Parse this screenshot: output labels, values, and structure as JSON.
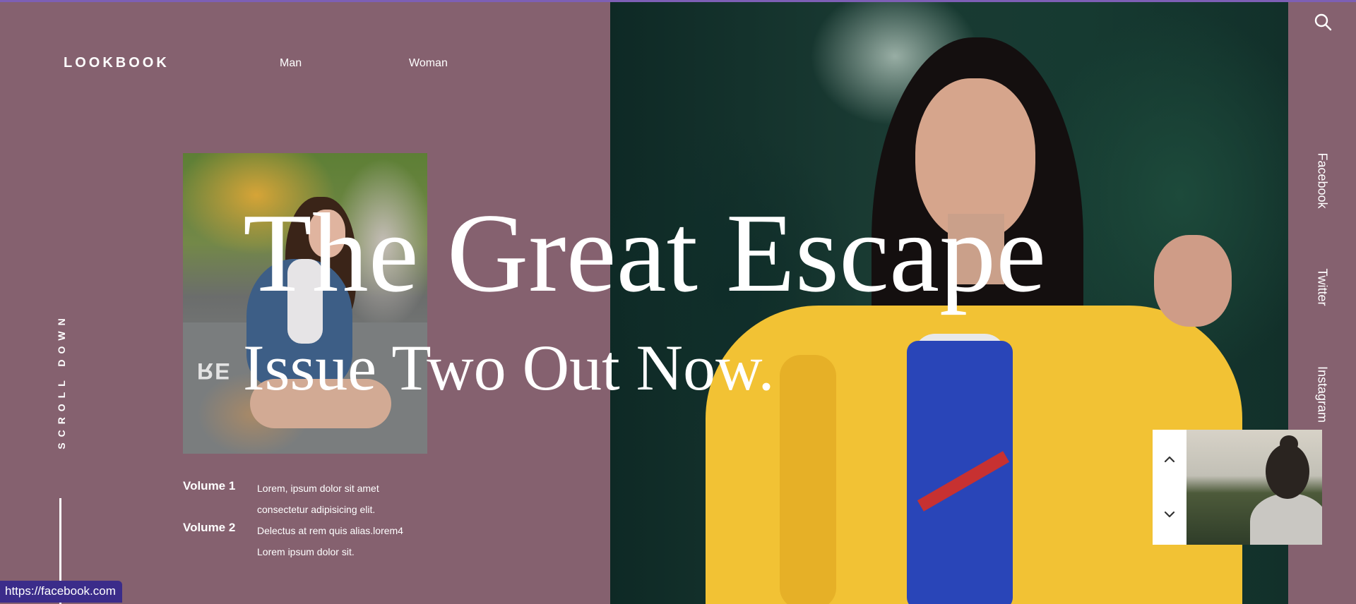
{
  "header": {
    "brand": "LOOKBOOK",
    "nav": [
      "Man",
      "Woman"
    ]
  },
  "hero": {
    "title": "The Great Escape",
    "subtitle": "Issue Two Out Now."
  },
  "volumes": [
    {
      "label": "Volume 1",
      "lines": [
        "Lorem, ipsum dolor sit amet",
        "consectetur adipisicing elit."
      ]
    },
    {
      "label": "Volume 2",
      "lines": [
        "Delectus at rem quis alias.lorem4",
        "Lorem ipsum dolor sit."
      ]
    }
  ],
  "scroll_label": "SCROLL DOWN",
  "social": [
    "Facebook",
    "Twitter",
    "Instagram"
  ],
  "status_url": "https://facebook.com",
  "icons": [
    "search-icon",
    "chevron-up-icon",
    "chevron-down-icon"
  ],
  "colors": {
    "background": "#85616f",
    "accent_bar": "#7d5fb5",
    "status_bg": "#3b2c8a",
    "text": "#ffffff"
  }
}
